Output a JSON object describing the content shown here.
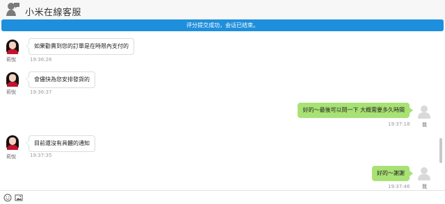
{
  "header": {
    "title": "小米在線客服"
  },
  "notice": {
    "text": "评分提交成功，会话已结束。"
  },
  "messages": [
    {
      "sender": "agent",
      "name": "莉悅",
      "text": "如果勸賣到您的訂單是在時限內支付的",
      "time": "19:36:26"
    },
    {
      "sender": "agent",
      "name": "莉悅",
      "text": "會儘快為您安排發貨的",
      "time": "19:36:37"
    },
    {
      "sender": "me",
      "name": "我",
      "text": "好的～最後可以問一下 大概需要多久時間",
      "time": "19:37:18"
    },
    {
      "sender": "agent",
      "name": "莉悅",
      "text": "目前還沒有具體的通知",
      "time": "19:37:35"
    },
    {
      "sender": "me",
      "name": "我",
      "text": "好的～謝謝",
      "time": "19:37:46"
    }
  ],
  "toolbar": {
    "icons": [
      "emoji-icon",
      "image-icon"
    ]
  }
}
